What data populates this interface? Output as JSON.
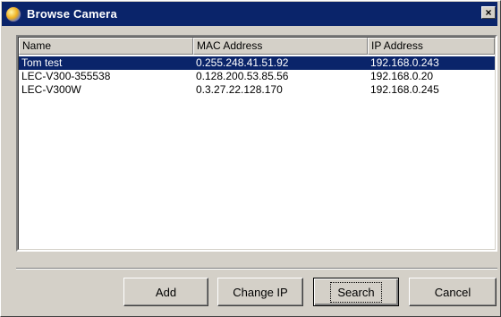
{
  "window": {
    "title": "Browse Camera",
    "close_glyph": "×"
  },
  "table": {
    "columns": [
      "Name",
      "MAC Address",
      "IP Address"
    ],
    "rows": [
      {
        "name": "Tom test",
        "mac": "0.255.248.41.51.92",
        "ip": "192.168.0.243",
        "selected": true
      },
      {
        "name": "LEC-V300-355538",
        "mac": "0.128.200.53.85.56",
        "ip": "192.168.0.20",
        "selected": false
      },
      {
        "name": "LEC-V300W",
        "mac": "0.3.27.22.128.170",
        "ip": "192.168.0.245",
        "selected": false
      }
    ]
  },
  "buttons": {
    "add": "Add",
    "change_ip": "Change IP",
    "search": "Search",
    "cancel": "Cancel"
  },
  "colors": {
    "titlebar": "#0a246a",
    "selection": "#0a246a",
    "face": "#d4d0c8"
  },
  "icons": {
    "app": "camera-app-icon",
    "close": "close-icon"
  }
}
